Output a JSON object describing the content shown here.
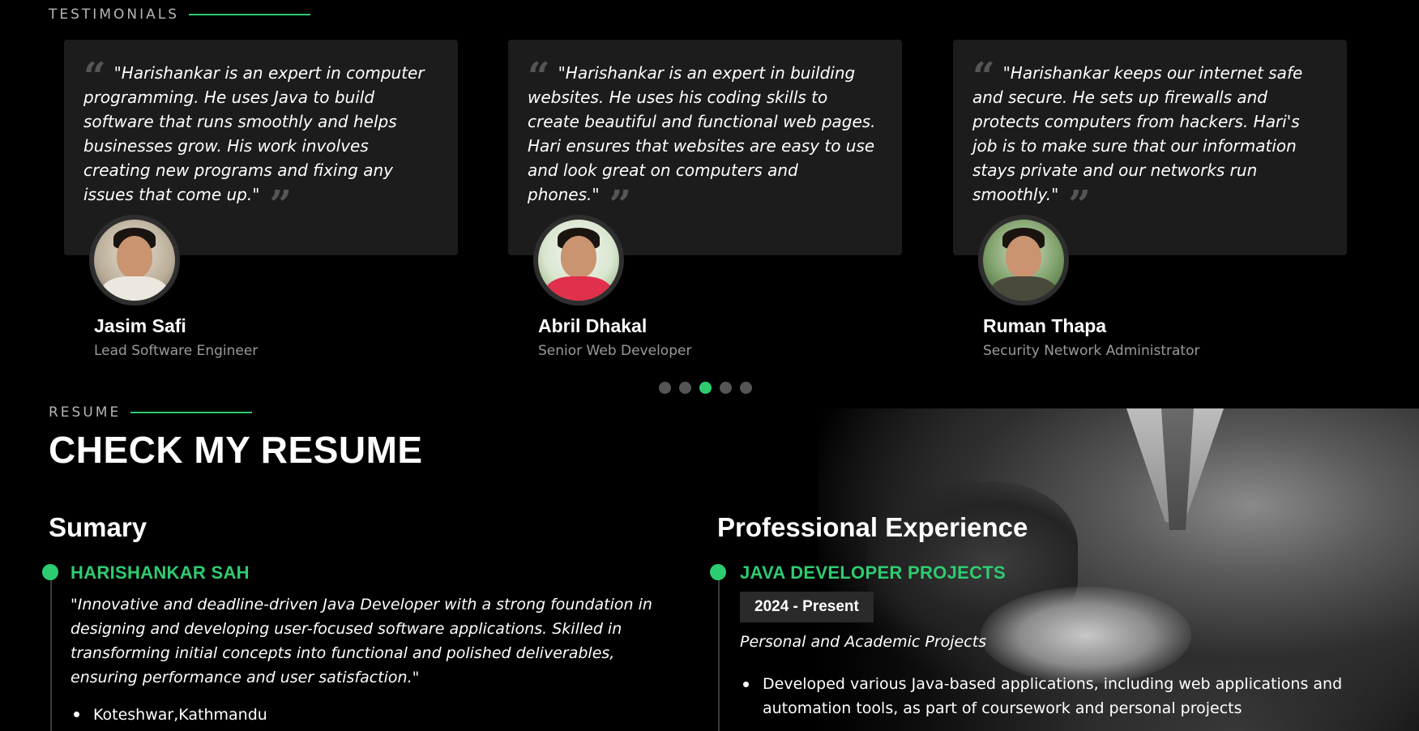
{
  "testimonials": {
    "label": "TESTIMONIALS",
    "items": [
      {
        "quote": "\"Harishankar is an expert in computer programming. He uses Java to build software that runs smoothly and helps businesses grow. His work involves creating new programs and fixing any issues that come up.\"",
        "name": "Jasim Safi",
        "role": "Lead Software Engineer"
      },
      {
        "quote": "\"Harishankar is an expert in building websites. He uses his coding skills to create beautiful and functional web pages. Hari ensures that websites are easy to use and look great on computers and phones.\"",
        "name": "Abril Dhakal",
        "role": "Senior Web Developer"
      },
      {
        "quote": "\"Harishankar keeps our internet safe and secure. He sets up firewalls and protects computers from hackers. Hari's job is to make sure that our information stays private and our networks run smoothly.\"",
        "name": "Ruman Thapa",
        "role": "Security Network Administrator"
      }
    ],
    "pagination": {
      "total": 5,
      "active_index": 2
    }
  },
  "resume": {
    "label": "RESUME",
    "title": "CHECK MY RESUME",
    "summary": {
      "heading": "Sumary",
      "name": "HARISHANKAR SAH",
      "text": "\"Innovative and deadline-driven Java Developer with a strong foundation in designing and developing user-focused software applications. Skilled in transforming initial concepts into functional and polished deliverables, ensuring performance and user satisfaction.\"",
      "bullets": [
        "Koteshwar,Kathmandu"
      ]
    },
    "experience": {
      "heading": "Professional Experience",
      "title": "JAVA DEVELOPER PROJECTS",
      "period": "2024 - Present",
      "subtitle": "Personal and Academic Projects",
      "bullets": [
        "Developed various Java-based applications, including web applications and automation tools, as part of coursework and personal projects"
      ]
    }
  },
  "colors": {
    "accent": "#2ecc71",
    "card": "#1c1c1c",
    "background": "#000000"
  }
}
